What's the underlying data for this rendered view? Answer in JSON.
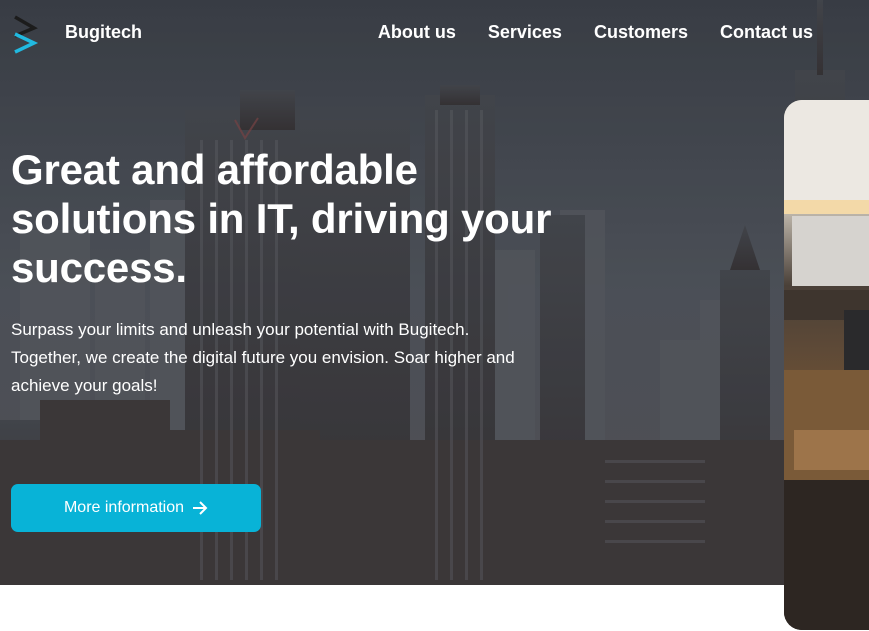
{
  "header": {
    "brand": "Bugitech",
    "nav": [
      {
        "label": "About us"
      },
      {
        "label": "Services"
      },
      {
        "label": "Customers"
      },
      {
        "label": "Contact us"
      }
    ]
  },
  "hero": {
    "headline": "Great and affordable solutions in IT, driving your success.",
    "subtext": "Surpass your limits and unleash your potential with Bugitech. Together, we create the digital future you envision. Soar higher and achieve your goals!",
    "cta_label": "More information",
    "cta_icon": "arrow-right-icon"
  },
  "colors": {
    "accent": "#08b3d7",
    "logo_dark": "#1c1c1c",
    "logo_light": "#21b9e0",
    "text": "#ffffff"
  }
}
